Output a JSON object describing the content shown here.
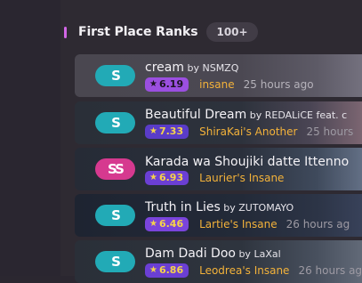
{
  "section": {
    "title": "First Place Ranks",
    "count": "100+"
  },
  "scores": [
    {
      "title": "cream",
      "by": "by",
      "artist": "NSMZQ",
      "stars": "6.19",
      "star_bg": "#9b4fe0",
      "star_fg": "#1a1320",
      "version": "insane",
      "time": "25 hours ago",
      "mode_icon": "osu-mania-icon",
      "mode_color": "#22aab6"
    },
    {
      "title": "Beautiful Dream",
      "by": "by",
      "artist": "REDALiCE feat. c",
      "stars": "7.33",
      "star_bg": "#5a3cc8",
      "star_fg": "#f5d34a",
      "version": "ShiraKai's Another",
      "time": "25 hours",
      "mode_icon": "osu-mania-icon",
      "mode_color": "#22aab6"
    },
    {
      "title": "Karada wa Shoujiki datte Ittenno",
      "by": "",
      "artist": "",
      "stars": "6.93",
      "star_bg": "#6b3fd4",
      "star_fg": "#f5d34a",
      "version": "Laurier's Insane",
      "time": "",
      "mode_icon": "osu-mania-icon",
      "mode_color": "#d6398f"
    },
    {
      "title": "Truth in Lies",
      "by": "by",
      "artist": "ZUTOMAYO",
      "stars": "6.46",
      "star_bg": "#7a44dc",
      "star_fg": "#f5d34a",
      "version": "Lartie's Insane",
      "time": "26 hours ag",
      "mode_icon": "osu-mania-icon",
      "mode_color": "#22aab6"
    },
    {
      "title": "Dam Dadi Doo",
      "by": "by",
      "artist": "LaXal",
      "stars": "6.86",
      "star_bg": "#6b3fd4",
      "star_fg": "#f5d34a",
      "version": "Leodrea's Insane",
      "time": "26 hours ag",
      "mode_icon": "osu-mania-icon",
      "mode_color": "#22aab6"
    }
  ]
}
